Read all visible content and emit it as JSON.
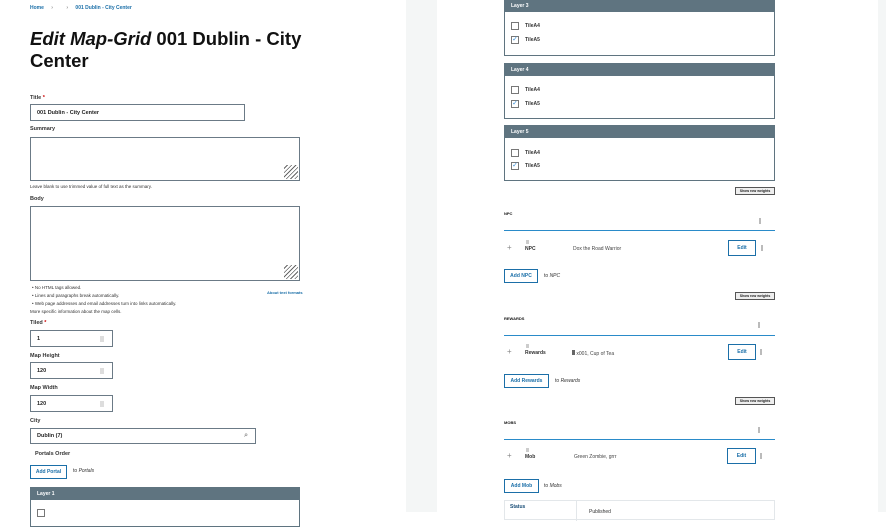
{
  "breadcrumb": {
    "home": "Home",
    "sep": "›",
    "current": "001 Dublin - City Center"
  },
  "title": {
    "italic": "Edit Map-Grid",
    "rest": "001 Dublin - City Center"
  },
  "form": {
    "title_label": "Title",
    "required_mark": "*",
    "title_value": "001 Dublin - City Center",
    "summary_label": "Summary",
    "summary_help": "Leave blank to use trimmed value of full text as the summary.",
    "body_label": "Body",
    "format_tips": [
      "No HTML tags allowed.",
      "Lines and paragraphs break automatically.",
      "Web page addresses and email addresses turn into links automatically."
    ],
    "about_formats": "About text formats",
    "more_info": "More specific information about the map cells.",
    "tiled_label": "Tiled",
    "tiled_value": "1",
    "height_label": "Map Height",
    "height_value": "120",
    "width_label": "Map Width",
    "width_value": "120",
    "city_label": "City",
    "city_value": "Dublin (7)",
    "portals_label": "Portals Order",
    "add_portal": "Add Portal",
    "to_portals_prefix": "to",
    "to_portals": "Portals"
  },
  "layers": [
    {
      "label": "Layer 1",
      "tiles": []
    },
    {
      "label": "Layer 3",
      "tiles": [
        {
          "label": "TileA4",
          "checked": false
        },
        {
          "label": "TileA5",
          "checked": true
        }
      ]
    },
    {
      "label": "Layer 4",
      "tiles": [
        {
          "label": "TileA4",
          "checked": false
        },
        {
          "label": "TileA5",
          "checked": true
        }
      ]
    },
    {
      "label": "Layer 5",
      "tiles": [
        {
          "label": "TileA4",
          "checked": false
        },
        {
          "label": "TileA5",
          "checked": true
        }
      ]
    }
  ],
  "show_row_weights": "Show row weights",
  "sections": [
    {
      "heading": "NPC",
      "row_label": "NPC",
      "row_value": "Dox the Road Warrior",
      "edit": "Edit",
      "add": "Add NPC",
      "to_prefix": "to",
      "to": "NPC"
    },
    {
      "heading": "REWARDS",
      "row_label": "Rewards",
      "row_value": "x001, Cup of Tea",
      "edit": "Edit",
      "add": "Add Rewards",
      "to_prefix": "to",
      "to": "Rewards"
    },
    {
      "heading": "MOBS",
      "row_label": "Mob",
      "row_value": "Green Zombie, grrr",
      "edit": "Edit",
      "add": "Add Mob",
      "to_prefix": "to",
      "to": "Mobs"
    }
  ],
  "status": {
    "label": "Status",
    "value": "Published"
  },
  "colors": {
    "accent": "#1b6fa8",
    "layer_header": "#5f7480",
    "divider": "#2a8bc9"
  }
}
